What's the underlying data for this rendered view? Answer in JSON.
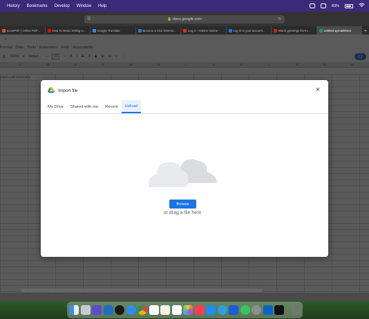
{
  "menubar": {
    "items": [
      "History",
      "Bookmarks",
      "Develop",
      "Window",
      "Help"
    ],
    "battery": "83%"
  },
  "safari": {
    "url": "docs.google.com"
  },
  "tabs": [
    {
      "label": "iLovePDF | Online PDF..."
    },
    {
      "label": "How To Music Selling A..."
    },
    {
      "label": "Google Translate"
    },
    {
      "label": "Become a Vice Director..."
    },
    {
      "label": "Log in - Hotsmr Online"
    },
    {
      "label": "Log in to your account..."
    },
    {
      "label": "Warm greetings from I..."
    },
    {
      "label": "Untitled spreadsheet"
    }
  ],
  "sheets": {
    "menu": [
      "Format",
      "Data",
      "Tools",
      "Extensions",
      "Help",
      "Accessibility"
    ],
    "zoom": "100%",
    "font": "Defaul...",
    "font_size": "10",
    "columns": [
      "C",
      "D",
      "E",
      "F",
      "G",
      "H",
      "I",
      "J",
      "K",
      "L",
      "M",
      "N",
      "O",
      "P"
    ],
    "cell_hint": "Insert a file smart chip"
  },
  "modal": {
    "title": "Import file",
    "close_label": "×",
    "tabs": [
      "My Drive",
      "Shared with me",
      "Recent",
      "Upload"
    ],
    "active_tab": "Upload",
    "browse_label": "Browse",
    "drag_text": "or drag a file here"
  },
  "colors": {
    "accent": "#1a73e8",
    "menubar": "#3b2a7a",
    "overlay_sheet": "#5a5a5a"
  }
}
